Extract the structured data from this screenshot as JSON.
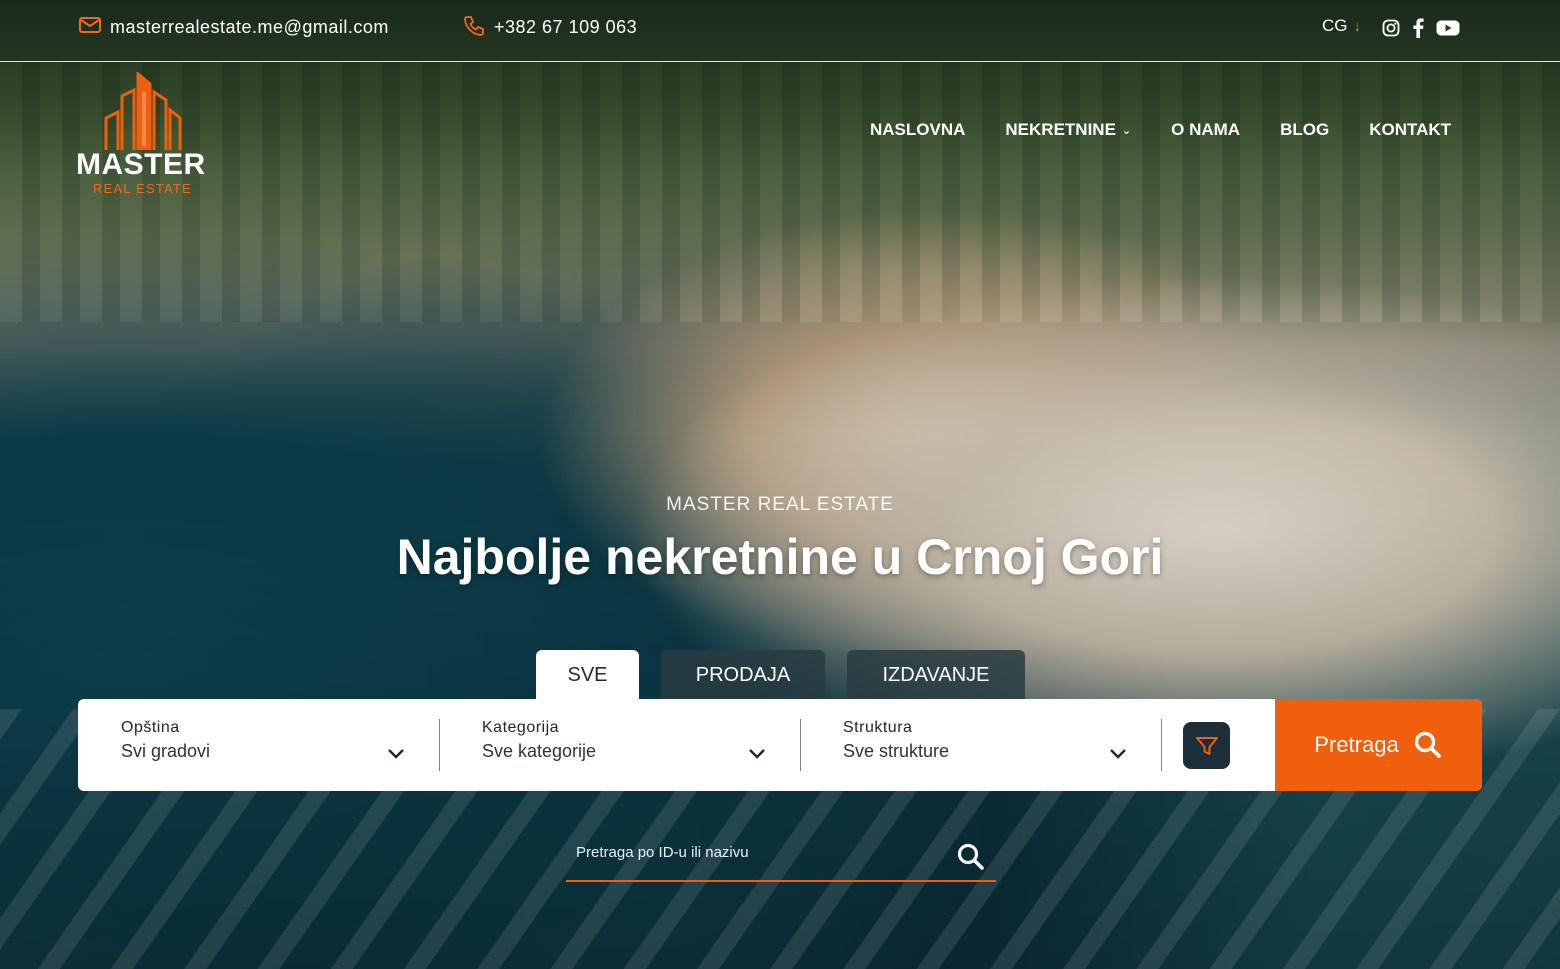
{
  "topbar": {
    "email": "masterrealestate.me@gmail.com",
    "phone": "+382 67 109 063",
    "language": "CG",
    "language_arrow": "↓",
    "socials": [
      "instagram-icon",
      "facebook-icon",
      "youtube-icon"
    ]
  },
  "logo": {
    "word": "MASTER",
    "sub": "REAL ESTATE"
  },
  "nav": {
    "items": [
      {
        "label": "NASLOVNA"
      },
      {
        "label": "NEKRETNINE",
        "dropdown": true
      },
      {
        "label": "O NAMA"
      },
      {
        "label": "BLOG"
      },
      {
        "label": "KONTAKT"
      }
    ]
  },
  "hero": {
    "kicker": "MASTER REAL ESTATE",
    "headline": "Najbolje nekretnine u Crnoj Gori"
  },
  "tabs": {
    "items": [
      {
        "label": "SVE",
        "active": true
      },
      {
        "label": "PRODAJA",
        "active": false
      },
      {
        "label": "IZDAVANJE",
        "active": false
      }
    ]
  },
  "search": {
    "fields": [
      {
        "label": "Opština",
        "value": "Svi gradovi"
      },
      {
        "label": "Kategorija",
        "value": "Sve kategorije"
      },
      {
        "label": "Struktura",
        "value": "Sve strukture"
      }
    ],
    "filter_icon": "filter-icon",
    "button_label": "Pretraga",
    "id_placeholder": "Pretraga po ID-u ili nazivu"
  },
  "colors": {
    "accent": "#ef5f0e",
    "dark": "#1e2d3a",
    "text": "#1e2630"
  }
}
